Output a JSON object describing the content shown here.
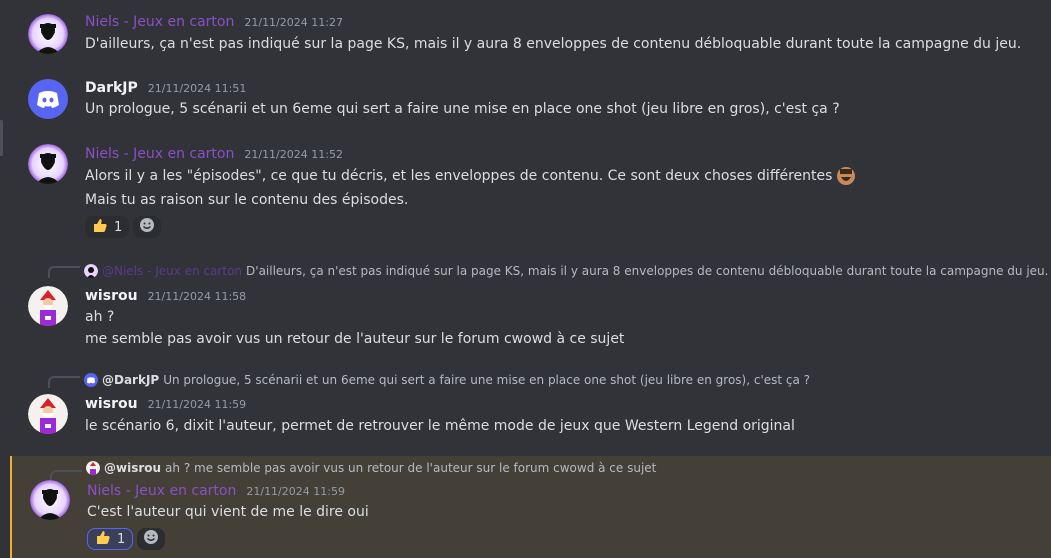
{
  "messages": [
    {
      "author": "Niels - Jeux en carton",
      "time": "21/11/2024 11:27",
      "lines": [
        "D'ailleurs, ça n'est pas indiqué sur la page KS, mais il y aura 8 enveloppes de contenu débloquable durant toute la campagne du jeu."
      ]
    },
    {
      "author": "DarkJP",
      "time": "21/11/2024 11:51",
      "lines": [
        "Un prologue, 5 scénarii et un 6eme qui sert a faire une mise en place one shot (jeu libre en gros), c'est ça ?"
      ]
    },
    {
      "author": "Niels - Jeux en carton",
      "time": "21/11/2024 11:52",
      "lines": [
        "Alors il y a les \"épisodes\", ce que tu décris, et les enveloppes de contenu. Ce sont deux choses différentes",
        "Mais tu as raison sur le contenu des épisodes."
      ],
      "reaction_count": "1"
    },
    {
      "reply_to": {
        "author": "@Niels - Jeux en carton",
        "text": "D'ailleurs, ça n'est pas indiqué sur la page KS, mais il y aura 8 enveloppes de contenu débloquable durant toute la campagne du jeu."
      },
      "author": "wisrou",
      "time": "21/11/2024 11:58",
      "lines": [
        "ah ?",
        "me semble pas avoir vus un retour de l'auteur sur le forum cwowd à ce sujet"
      ]
    },
    {
      "reply_to": {
        "author": "@DarkJP",
        "text": "Un prologue, 5 scénarii et un 6eme qui sert a faire une mise en place one shot (jeu libre en gros), c'est ça ?"
      },
      "author": "wisrou",
      "time": "21/11/2024 11:59",
      "lines": [
        "le scénario 6, dixit l'auteur, permet de retrouver le même mode de jeux que Western Legend original"
      ]
    },
    {
      "reply_to": {
        "author": "@wisrou",
        "text": "ah ? me semble pas avoir vus un retour de l'auteur sur le forum cwowd à ce sujet"
      },
      "author": "Niels - Jeux en carton",
      "time": "21/11/2024 11:59",
      "lines": [
        "C'est l'auteur qui vient de me le dire oui"
      ],
      "reaction_count": "1"
    }
  ],
  "icons": {
    "thumbs_up": "thumbs-up-emoji",
    "add_reaction": "add-reaction-icon",
    "discord": "discord-logo"
  },
  "colors": {
    "niels_name": "#8b4fc7",
    "highlight_bar": "#f0b132",
    "blurple": "#5865f2"
  }
}
